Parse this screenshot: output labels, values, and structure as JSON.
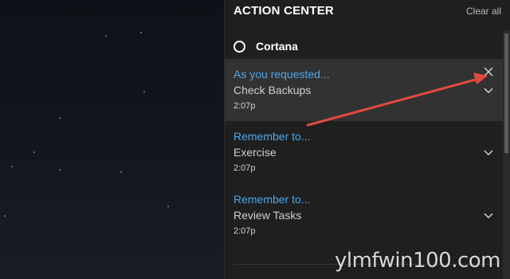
{
  "action_center": {
    "title": "ACTION CENTER",
    "clear_all": "Clear all",
    "app_group": {
      "icon": "cortana-ring-icon",
      "name": "Cortana"
    },
    "notifications": [
      {
        "title": "As you requested...",
        "body": "Check Backups",
        "time": "2:07p",
        "hovered": true
      },
      {
        "title": "Remember to...",
        "body": "Exercise",
        "time": "2:07p",
        "hovered": false
      },
      {
        "title": "Remember to...",
        "body": "Review Tasks",
        "time": "2:07p",
        "hovered": false
      }
    ]
  },
  "colors": {
    "accent": "#4ea7e8",
    "panel": "#1f1f1f",
    "hover": "#323232",
    "arrow": "#e04a3f"
  },
  "watermark": {
    "text": "ylmfwin100.com"
  }
}
